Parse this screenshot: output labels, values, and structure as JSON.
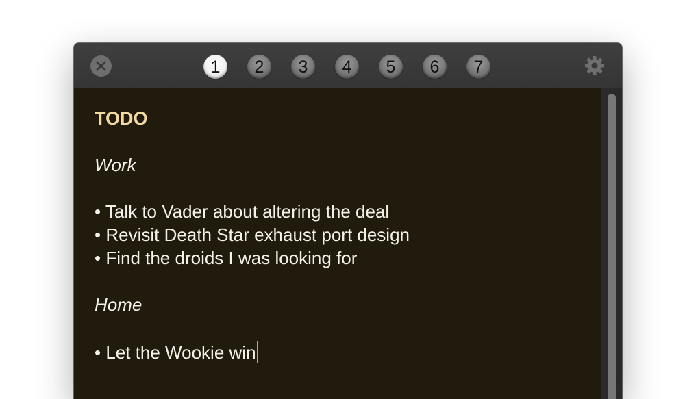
{
  "titlebar": {
    "tabs": [
      {
        "label": "1",
        "active": true
      },
      {
        "label": "2",
        "active": false
      },
      {
        "label": "3",
        "active": false
      },
      {
        "label": "4",
        "active": false
      },
      {
        "label": "5",
        "active": false
      },
      {
        "label": "6",
        "active": false
      },
      {
        "label": "7",
        "active": false
      }
    ],
    "close_icon": "close-icon",
    "settings_icon": "gear-icon"
  },
  "note": {
    "heading": "TODO",
    "sections": [
      {
        "title": "Work",
        "items": [
          "• Talk to Vader about altering the deal",
          "• Revisit Death Star exhaust port design",
          "• Find the droids I was looking for"
        ]
      },
      {
        "title": "Home",
        "items": [
          "• Let the Wookie win"
        ]
      }
    ]
  },
  "colors": {
    "background": "#211b0d",
    "heading": "#f3d9a2",
    "text": "#f4f1ea",
    "titlebar": "#3a3a3b",
    "caret": "#d7a64a"
  }
}
